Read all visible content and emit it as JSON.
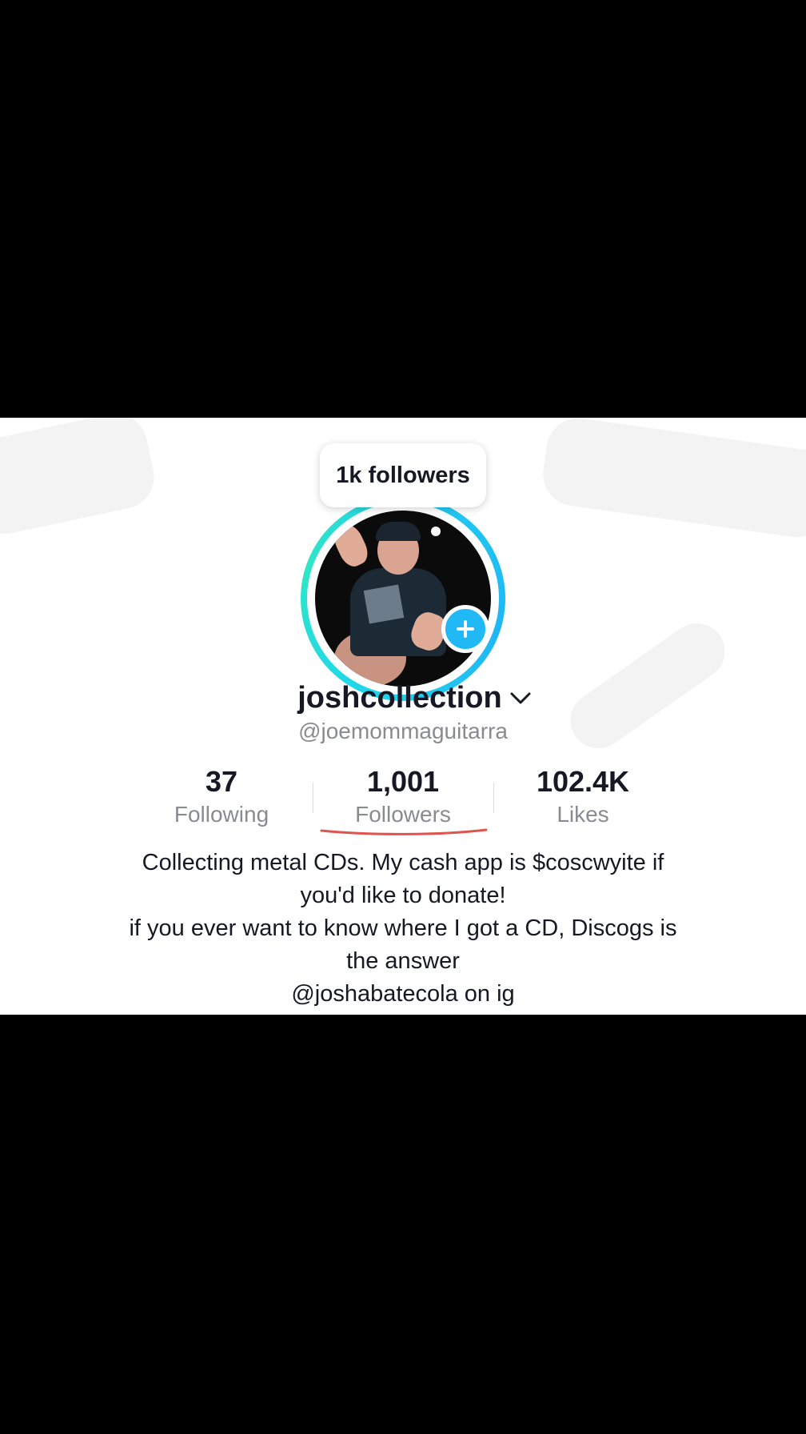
{
  "tooltip": {
    "text": "1k followers"
  },
  "profile": {
    "display_name": "joshcollection",
    "handle": "@joemommaguitarra"
  },
  "stats": {
    "following": {
      "value": "37",
      "label": "Following"
    },
    "followers": {
      "value": "1,001",
      "label": "Followers"
    },
    "likes": {
      "value": "102.4K",
      "label": "Likes"
    }
  },
  "bio": {
    "lines": [
      "Collecting metal CDs. My cash app is $coscwyite if",
      "you'd like to donate!",
      "if you ever want to know where I got a CD, Discogs is",
      "the answer",
      "@joshabatecola on ig"
    ]
  },
  "icons": {
    "dropdown": "chevron-down-icon",
    "follow_badge": "plus-icon"
  },
  "colors": {
    "ring_gradient": [
      "#20d5ec",
      "#2ee6c6",
      "#1fb6f5"
    ],
    "plus_badge": "#20b8f5",
    "annotation_underline": "#e0534f",
    "primary_text": "#161823",
    "secondary_text": "#8a8b91"
  }
}
